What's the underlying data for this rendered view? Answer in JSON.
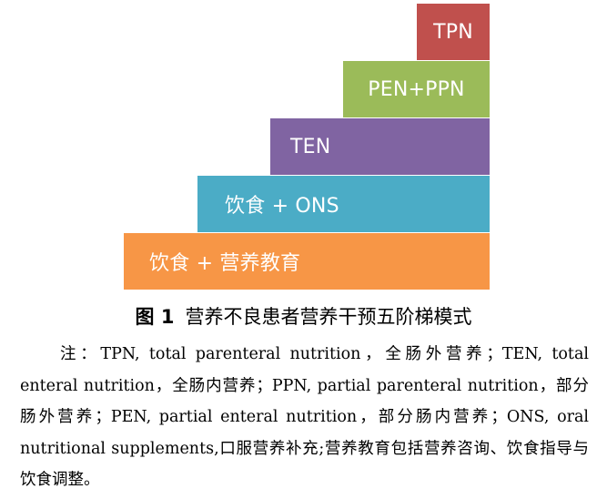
{
  "figure": {
    "steps": [
      {
        "key": "tpn",
        "label": "TPN",
        "color": "#c0504d"
      },
      {
        "key": "pen_ppn",
        "label": "PEN+PPN",
        "color": "#9bbb59"
      },
      {
        "key": "ten",
        "label": "TEN",
        "color": "#8064a2"
      },
      {
        "key": "ons",
        "label": "饮食 + ONS",
        "color": "#4bacc6"
      },
      {
        "key": "edu",
        "label": "饮食 + 营养教育",
        "color": "#f79646"
      }
    ],
    "caption_label": "图 1",
    "caption_text": "营养不良患者营养干预五阶梯模式"
  },
  "note": {
    "text": "注：TPN, total parenteral nutrition，全肠外营养；TEN, total enteral nutrition，全肠内营养；PPN, partial parenteral nutrition，部分肠外营养；PEN, partial enteral nutrition，部分肠内营养；ONS, oral nutritional supplements,口服营养补充;营养教育包括营养咨询、饮食指导与饮食调整。"
  }
}
